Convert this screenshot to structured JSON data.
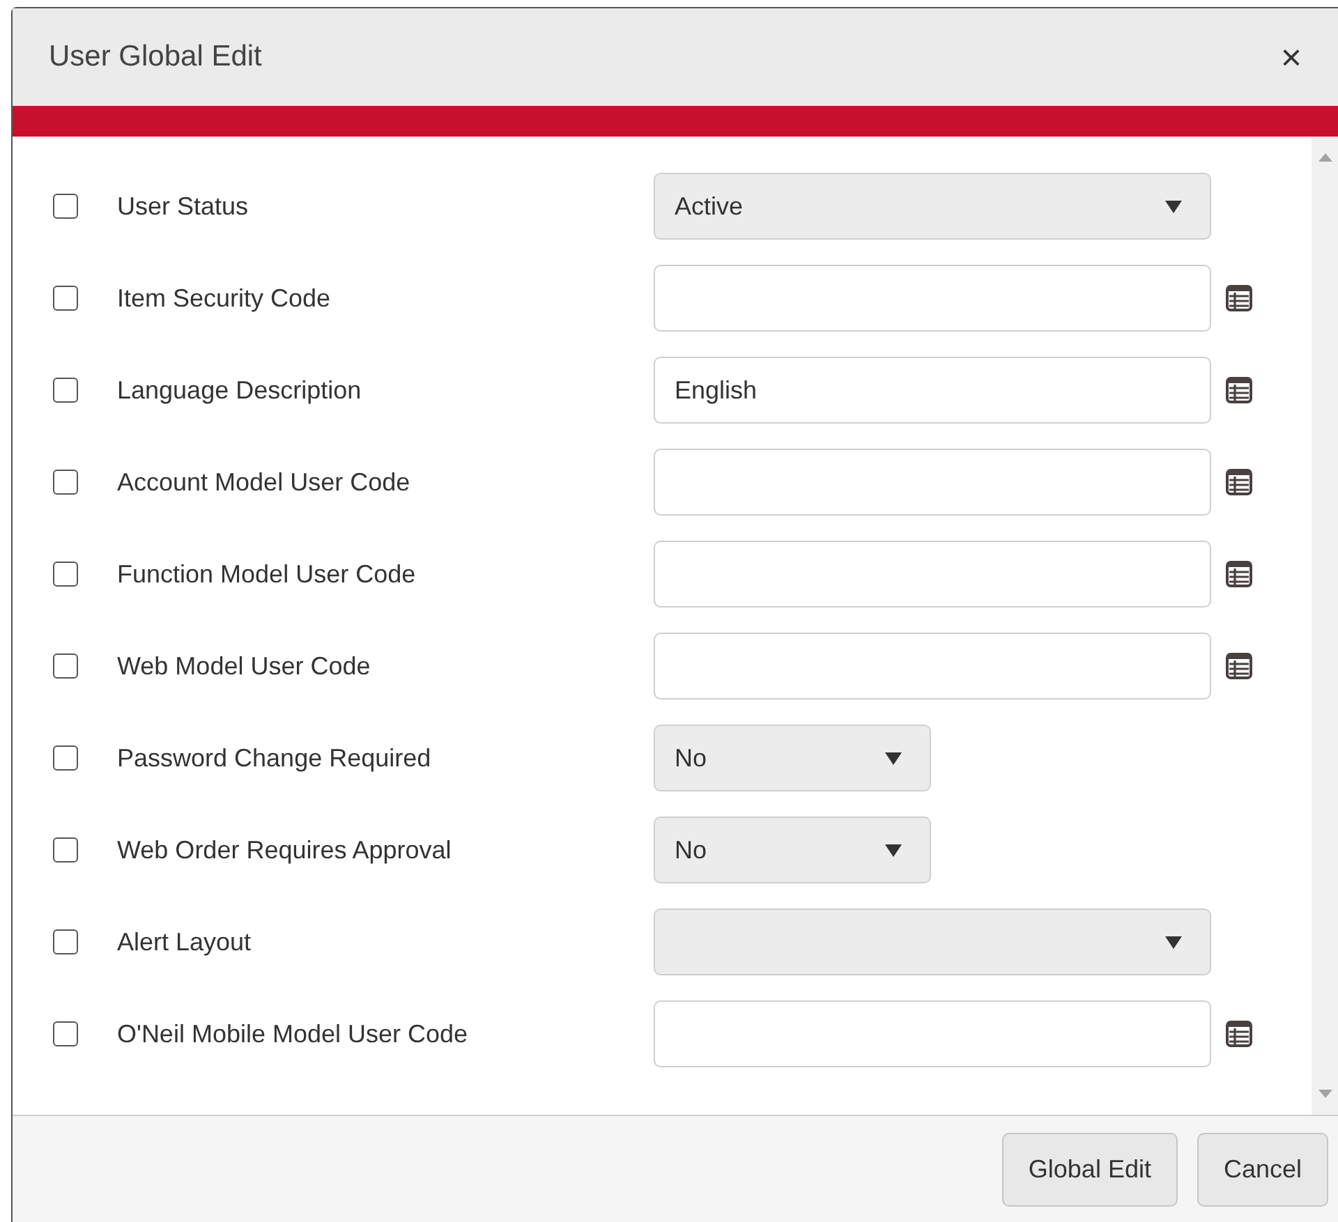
{
  "dialog": {
    "title": "User Global Edit",
    "close": "×"
  },
  "rows": [
    {
      "label": "User Status",
      "checked": false,
      "kind": "select",
      "value": "Active"
    },
    {
      "label": "Item Security Code",
      "checked": false,
      "kind": "lookup",
      "value": ""
    },
    {
      "label": "Language Description",
      "checked": false,
      "kind": "lookup",
      "value": "English"
    },
    {
      "label": "Account Model User Code",
      "checked": false,
      "kind": "lookup",
      "value": ""
    },
    {
      "label": "Function Model User Code",
      "checked": false,
      "kind": "lookup",
      "value": ""
    },
    {
      "label": "Web Model User Code",
      "checked": false,
      "kind": "lookup",
      "value": ""
    },
    {
      "label": "Password Change Required",
      "checked": false,
      "kind": "short-select",
      "value": "No"
    },
    {
      "label": "Web Order Requires Approval",
      "checked": false,
      "kind": "short-select",
      "value": "No"
    },
    {
      "label": "Alert Layout",
      "checked": false,
      "kind": "select",
      "value": ""
    },
    {
      "label": "O'Neil Mobile Model User Code",
      "checked": false,
      "kind": "lookup",
      "value": ""
    }
  ],
  "buttons": [
    "Global Edit",
    "Cancel"
  ]
}
